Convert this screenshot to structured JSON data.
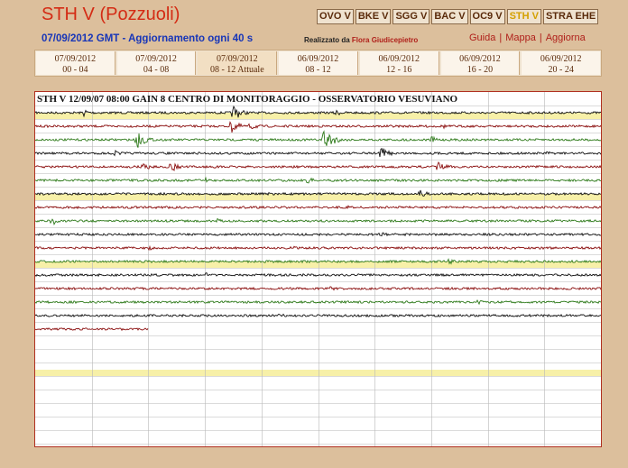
{
  "header": {
    "title": "STH V (Pozzuoli)",
    "date_gmt": "07/09/2012 GMT - Aggiornamento ogni 40 s",
    "credit_prefix": "Realizzato da",
    "credit_author": "Flora Giudicepietro"
  },
  "stations": [
    {
      "label": "OVO V",
      "active": false
    },
    {
      "label": "BKE V",
      "active": false
    },
    {
      "label": "SGG V",
      "active": false
    },
    {
      "label": "BAC V",
      "active": false
    },
    {
      "label": "OC9 V",
      "active": false
    },
    {
      "label": "STH V",
      "active": true
    },
    {
      "label": "STRA EHE",
      "active": false
    }
  ],
  "links": {
    "guida": "Guida",
    "mappa": "Mappa",
    "aggiorna": "Aggiorna",
    "sep": "|"
  },
  "time_tabs": [
    {
      "date": "07/09/2012",
      "range": "00 - 04"
    },
    {
      "date": "07/09/2012",
      "range": "04 - 08"
    },
    {
      "date": "07/09/2012",
      "range": "08 - 12 Attuale",
      "active": true
    },
    {
      "date": "06/09/2012",
      "range": "08 - 12"
    },
    {
      "date": "06/09/2012",
      "range": "12 - 16"
    },
    {
      "date": "06/09/2012",
      "range": "16 - 20"
    },
    {
      "date": "06/09/2012",
      "range": "20 - 24"
    }
  ],
  "plot": {
    "header": "STH V 12/09/07 08:00 GAIN 8  CENTRO DI MONITORAGGIO - OSSERVATORIO VESUVIANO",
    "trace_colors": [
      "#111111",
      "#8b0f0f",
      "#2e7a1a"
    ],
    "highlight_color": "#f7f0a8",
    "grid_color": "#b8b8b8",
    "trace_count": 17,
    "last_trace_fraction": 0.2,
    "highlight_rows": [
      1,
      7,
      12,
      20
    ]
  }
}
